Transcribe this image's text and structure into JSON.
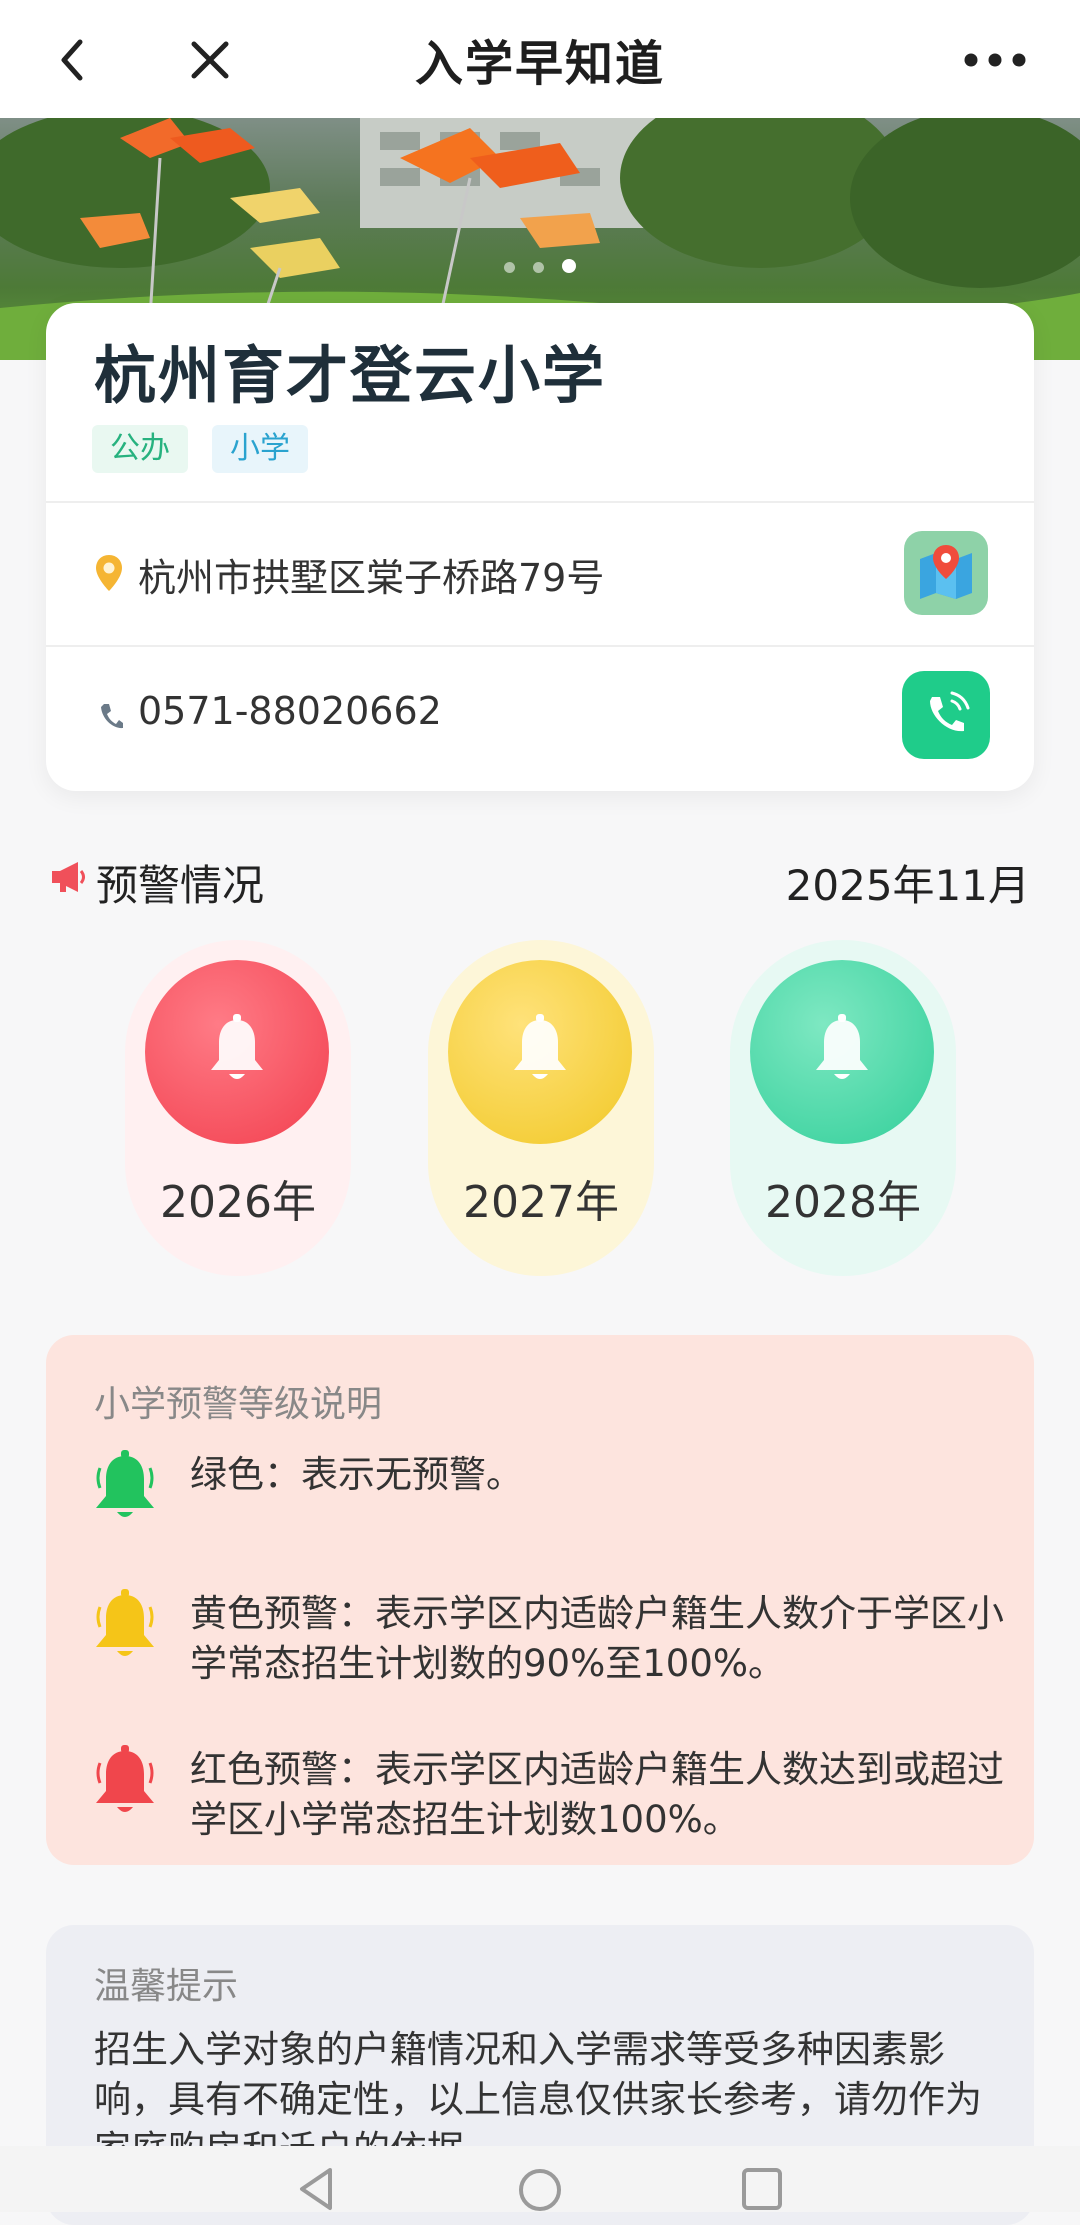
{
  "app": {
    "title": "入学早知道"
  },
  "school": {
    "name": "杭州育才登云小学",
    "tags": [
      "公办",
      "小学"
    ],
    "address": "杭州市拱墅区棠子桥路79号",
    "phone": "0571-88020662"
  },
  "warning": {
    "title": "预警情况",
    "date": "2025年11月",
    "years": [
      {
        "label": "2026年",
        "level": "red",
        "color": "#f2404f"
      },
      {
        "label": "2027年",
        "level": "yellow",
        "color": "#f1c826"
      },
      {
        "label": "2028年",
        "level": "green",
        "color": "#33cf9a"
      }
    ]
  },
  "explanation": {
    "title": "小学预警等级说明",
    "levels": [
      {
        "icon": "green-bell-icon",
        "color": "#22c35e",
        "text": "绿色：表示无预警。"
      },
      {
        "icon": "yellow-bell-icon",
        "color": "#f5c518",
        "text": "黄色预警：表示学区内适龄户籍生人数介于学区小学常态招生计划数的90%至100%。"
      },
      {
        "icon": "red-bell-icon",
        "color": "#f0464c",
        "text": "红色预警：表示学区内适龄户籍生人数达到或超过学区小学常态招生计划数100%。"
      }
    ]
  },
  "tip": {
    "title": "温馨提示",
    "body": "招生入学对象的户籍情况和入学需求等受多种因素影响，具有不确定性，以上信息仅供家长参考，请勿作为家庭购房和迁户的依据。"
  },
  "colors": {
    "accent_green": "#1fcc8a",
    "tag_green": "#27b27f",
    "tag_blue": "#2aa3cf"
  }
}
